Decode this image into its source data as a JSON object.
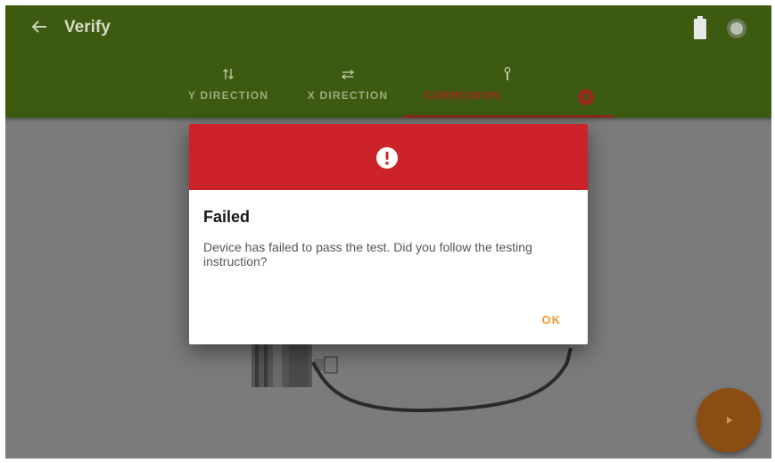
{
  "appbar": {
    "back_icon": "arrow-left-icon",
    "title": "Verify",
    "battery_icon": "battery-full-icon",
    "status_icon": "status-dot-icon"
  },
  "tabs": [
    {
      "label": "Y DIRECTION",
      "icon": "arrows-vertical-icon",
      "active": false
    },
    {
      "label": "X DIRECTION",
      "icon": "arrows-horizontal-icon",
      "active": false
    },
    {
      "label": "CORROSION",
      "icon": "probe-icon",
      "active": true,
      "status_icon": "fail-x-icon"
    }
  ],
  "dialog": {
    "header_icon": "alert-exclamation-icon",
    "title": "Failed",
    "message": "Device has failed to pass the test. Did you follow the testing instruction?",
    "ok_label": "OK"
  },
  "fab": {
    "icon": "play-icon"
  },
  "colors": {
    "appbar": "#3c5a10",
    "overlay": "#7b7b7b",
    "dialog_header": "#cc2229",
    "accent_ok": "#f0982e",
    "fab": "#8a4e12",
    "active_tab": "#a82a22"
  }
}
